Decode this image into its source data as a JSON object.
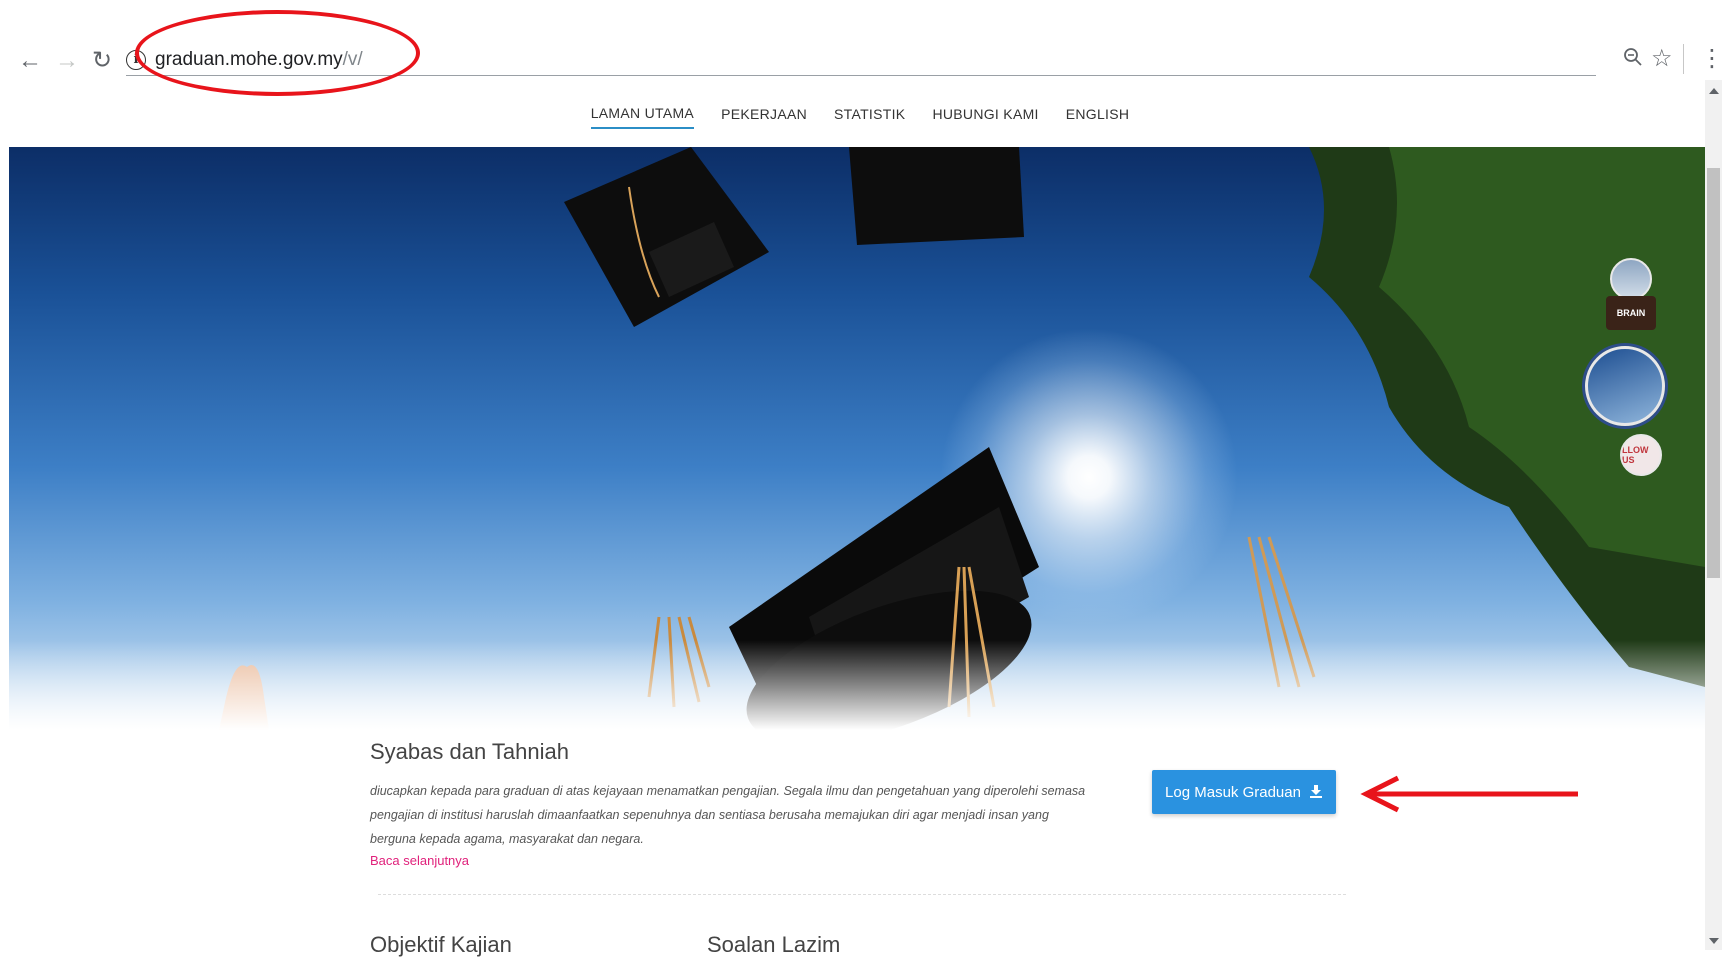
{
  "browser": {
    "back_icon": "arrow-left-icon",
    "forward_icon": "arrow-right-icon",
    "reload_icon": "reload-icon",
    "info_icon": "info-icon",
    "url_host": "graduan.mohe.gov.my",
    "url_path": "/v/",
    "zoom_icon": "zoom-out-icon",
    "star_icon": "star-icon",
    "menu_icon": "more-vert-icon"
  },
  "nav": {
    "items": [
      {
        "label": "LAMAN UTAMA",
        "active": true
      },
      {
        "label": "PEKERJAAN",
        "active": false
      },
      {
        "label": "STATISTIK",
        "active": false
      },
      {
        "label": "HUBUNGI KAMI",
        "active": false
      },
      {
        "label": "ENGLISH",
        "active": false
      }
    ]
  },
  "hero": {
    "indicators": [
      {
        "label": ""
      },
      {
        "label": "BRAIN"
      },
      {
        "label": ""
      },
      {
        "label": "LLOW US"
      }
    ]
  },
  "main": {
    "title": "Syabas dan Tahniah",
    "intro_line1": "diucapkan kepada para graduan di atas kejayaan menamatkan pengajian. Segala ilmu dan pengetahuan yang diperolehi semasa",
    "intro_line2": "pengajian di institusi haruslah dimaanfaatkan sepenuhnya dan sentiasa berusaha memajukan diri agar menjadi insan yang",
    "intro_line3": "berguna kepada agama, masyarakat dan negara.",
    "read_more": "Baca selanjutnya",
    "login_button": "Log Masuk Graduan",
    "login_icon": "download-icon",
    "section1": "Objektif Kajian",
    "section2": "Soalan Lazim"
  },
  "colors": {
    "annotation": "#e8141b",
    "primary_button": "#2a92e0",
    "link": "#e0217b",
    "nav_active_underline": "#2b8ec6"
  }
}
